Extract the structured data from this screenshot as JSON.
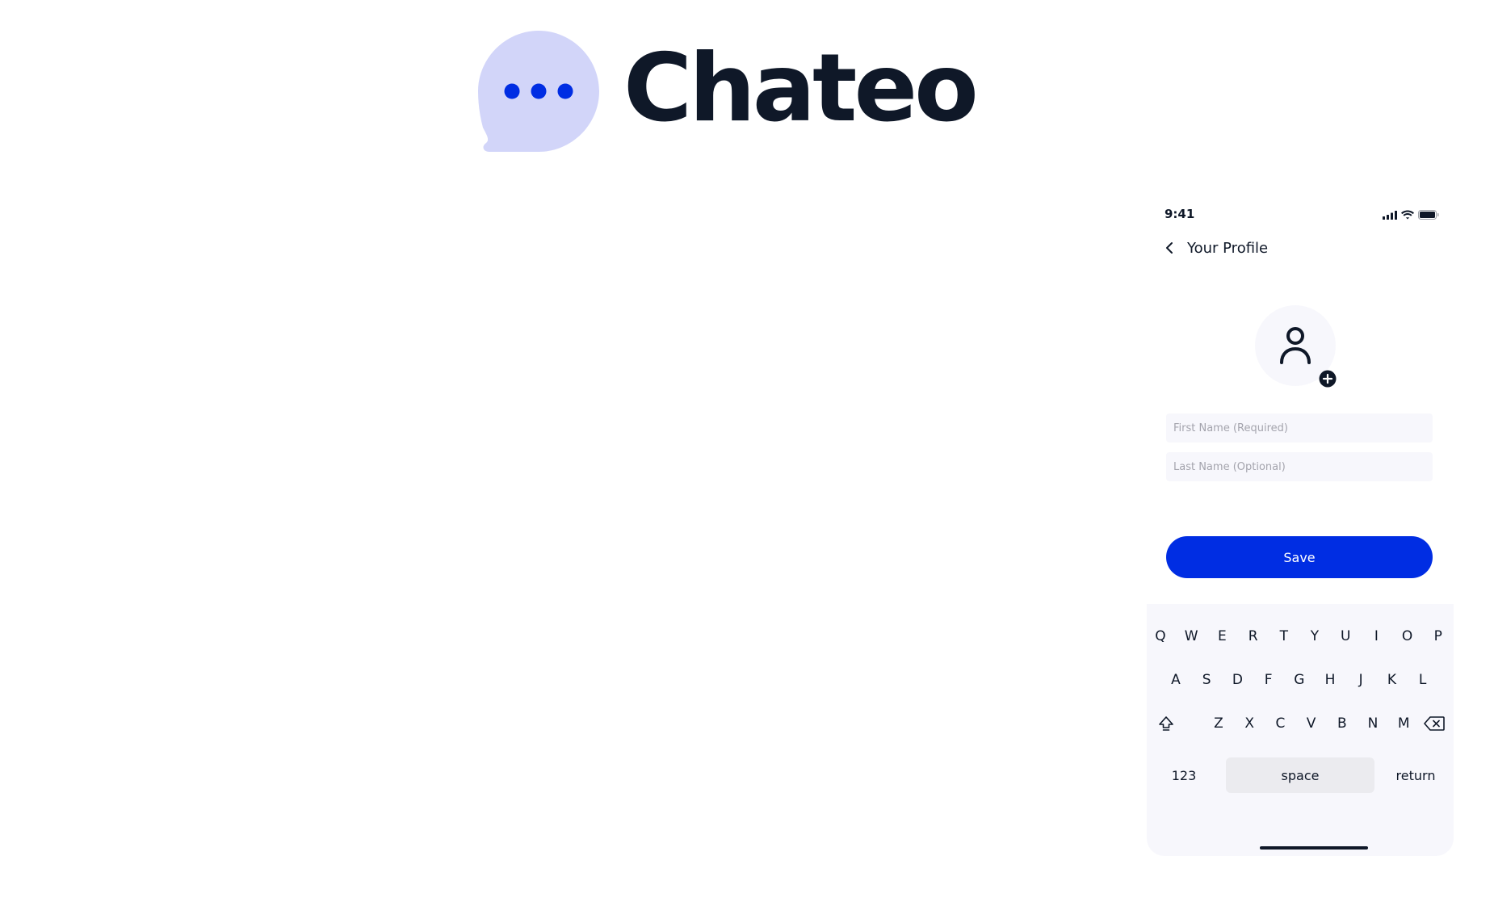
{
  "brand": {
    "name": "Chateo",
    "colors": {
      "bubble": "#d2d5f9",
      "dots": "#002de3",
      "text": "#0f1828"
    }
  },
  "status_bar": {
    "time": "9:41"
  },
  "nav": {
    "title": "Your Profile"
  },
  "form": {
    "first_name_placeholder": "First Name (Required)",
    "last_name_placeholder": "Last Name (Optional)",
    "first_name_value": "",
    "last_name_value": "",
    "save_label": "Save"
  },
  "keyboard": {
    "row1": [
      "Q",
      "W",
      "E",
      "R",
      "T",
      "Y",
      "U",
      "I",
      "O",
      "P"
    ],
    "row2": [
      "A",
      "S",
      "D",
      "F",
      "G",
      "H",
      "J",
      "K",
      "L"
    ],
    "row3": [
      "Z",
      "X",
      "C",
      "V",
      "B",
      "N",
      "M"
    ],
    "numbers_label": "123",
    "space_label": "space",
    "return_label": "return"
  },
  "colors": {
    "accent": "#002de3",
    "surface": "#f7f7fc",
    "text": "#0f1828",
    "placeholder": "#a4a4ad"
  },
  "icons": [
    "chat-bubble-icon",
    "signal-icon",
    "wifi-icon",
    "battery-icon",
    "chevron-left-icon",
    "person-icon",
    "plus-circle-icon",
    "shift-icon",
    "backspace-icon"
  ]
}
